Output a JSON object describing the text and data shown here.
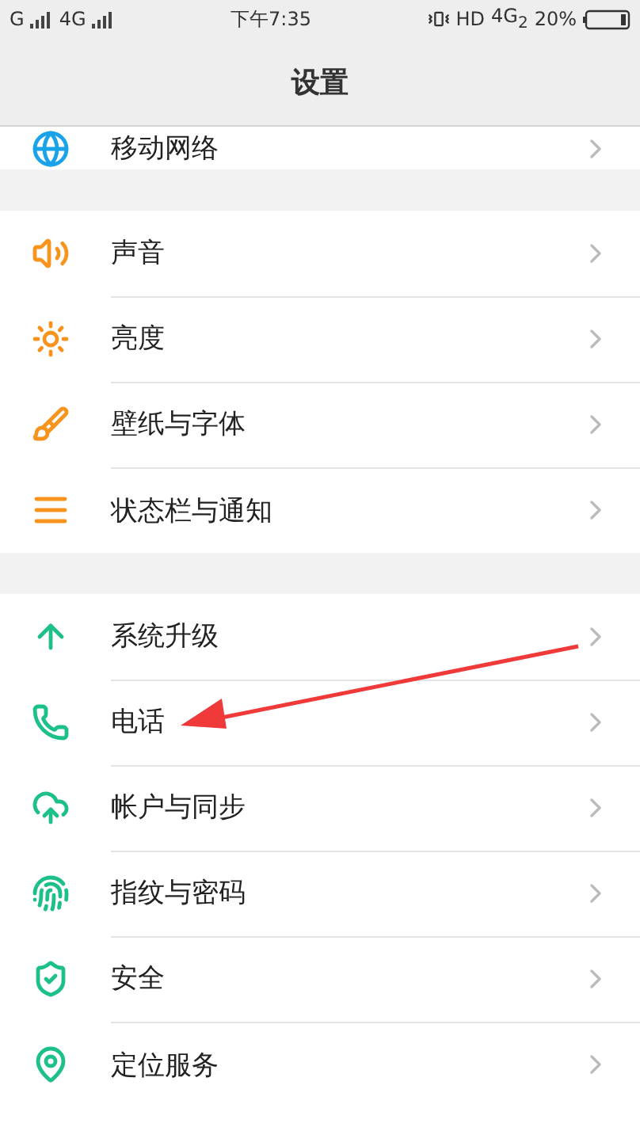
{
  "status_bar": {
    "signal_1": "G",
    "signal_2": "4G",
    "time": "下午7:35",
    "hd": "HD",
    "network": "4G$_{2}$",
    "battery": "20%"
  },
  "header": {
    "title": "设置"
  },
  "sections": [
    {
      "items": [
        {
          "label": "移动网络"
        }
      ]
    },
    {
      "items": [
        {
          "label": "声音"
        },
        {
          "label": "亮度"
        },
        {
          "label": "壁纸与字体"
        },
        {
          "label": "状态栏与通知"
        }
      ]
    },
    {
      "items": [
        {
          "label": "系统升级"
        },
        {
          "label": "电话"
        },
        {
          "label": "帐户与同步"
        },
        {
          "label": "指纹与密码"
        },
        {
          "label": "安全"
        },
        {
          "label": "定位服务"
        }
      ]
    }
  ]
}
